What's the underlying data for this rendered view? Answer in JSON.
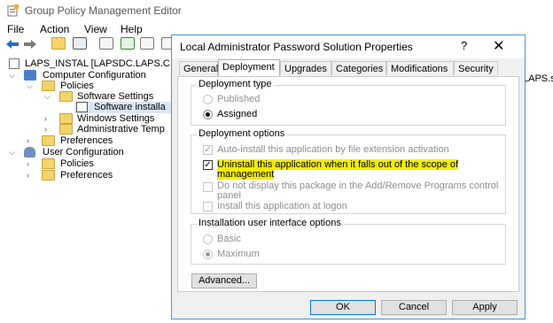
{
  "editor": {
    "title": "Group Policy Management Editor",
    "menu": [
      "File",
      "Action",
      "View",
      "Help"
    ],
    "tree": {
      "root": "LAPS_INSTAL [LAPSDC.LAPS.C",
      "computer_config": "Computer Configuration",
      "policies": "Policies",
      "software_settings": "Software Settings",
      "software_install": "Software installa",
      "windows_settings": "Windows Settings",
      "admin_templates": "Administrative Temp",
      "preferences": "Preferences",
      "user_config": "User Configuration",
      "user_policies": "Policies",
      "user_preferences": "Preferences"
    },
    "right_pane_text": "LAPS.s"
  },
  "dialog": {
    "title": "Local Administrator Password Solution Properties",
    "help": "?",
    "close": "✕",
    "tabs": [
      "General",
      "Deployment",
      "Upgrades",
      "Categories",
      "Modifications",
      "Security"
    ],
    "selected_tab": "Deployment",
    "deployment_type": {
      "label": "Deployment type",
      "published": "Published",
      "assigned": "Assigned"
    },
    "deployment_options": {
      "label": "Deployment options",
      "auto_install": "Auto-install this application by file extension activation",
      "uninstall_line1": "Uninstall this application when it falls out of the scope of",
      "uninstall_line2": "management",
      "no_display_line1": "Do not display this package in the Add/Remove Programs control",
      "no_display_line2": "panel",
      "install_logon": "Install this application at logon"
    },
    "install_ui": {
      "label": "Installation user interface options",
      "basic": "Basic",
      "maximum": "Maximum"
    },
    "advanced_button": "Advanced...",
    "ok_button": "OK",
    "cancel_button": "Cancel",
    "apply_button": "Apply"
  }
}
